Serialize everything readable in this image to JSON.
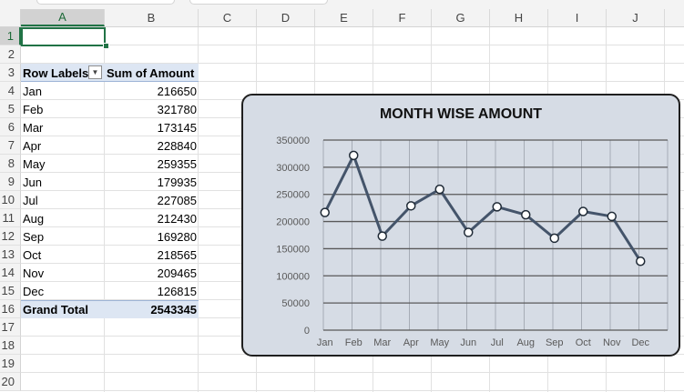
{
  "columns": [
    "A",
    "B",
    "C",
    "D",
    "E",
    "F",
    "G",
    "H",
    "I",
    "J"
  ],
  "rows": [
    "1",
    "2",
    "3",
    "4",
    "5",
    "6",
    "7",
    "8",
    "9",
    "10",
    "11",
    "12",
    "13",
    "14",
    "15",
    "16",
    "17",
    "18",
    "19",
    "20"
  ],
  "pivot": {
    "header_row_labels": "Row Labels",
    "header_sum": "Sum of Amount",
    "rows": [
      {
        "label": "Jan",
        "value": "216650"
      },
      {
        "label": "Feb",
        "value": "321780"
      },
      {
        "label": "Mar",
        "value": "173145"
      },
      {
        "label": "Apr",
        "value": "228840"
      },
      {
        "label": "May",
        "value": "259355"
      },
      {
        "label": "Jun",
        "value": "179935"
      },
      {
        "label": "Jul",
        "value": "227085"
      },
      {
        "label": "Aug",
        "value": "212430"
      },
      {
        "label": "Sep",
        "value": "169280"
      },
      {
        "label": "Oct",
        "value": "218565"
      },
      {
        "label": "Nov",
        "value": "209465"
      },
      {
        "label": "Dec",
        "value": "126815"
      }
    ],
    "total_label": "Grand Total",
    "total_value": "2543345",
    "filter_icon": "dropdown-arrow-icon"
  },
  "chart_data": {
    "type": "line",
    "title": "MONTH WISE AMOUNT",
    "categories": [
      "Jan",
      "Feb",
      "Mar",
      "Apr",
      "May",
      "Jun",
      "Jul",
      "Aug",
      "Sep",
      "Oct",
      "Nov",
      "Dec"
    ],
    "series": [
      {
        "values": [
          216650,
          321780,
          173145,
          228840,
          259355,
          179935,
          227085,
          212430,
          169280,
          218565,
          209465,
          126815
        ]
      }
    ],
    "ylim": [
      0,
      350000
    ],
    "yticks": [
      "350000",
      "300000",
      "250000",
      "200000",
      "150000",
      "100000",
      "50000",
      "0"
    ],
    "grid": true,
    "line_color": "#44546a",
    "background_color": "#d6dce5"
  },
  "colors": {
    "selection_green": "#217346",
    "pivot_header_fill": "#dde6f3"
  }
}
